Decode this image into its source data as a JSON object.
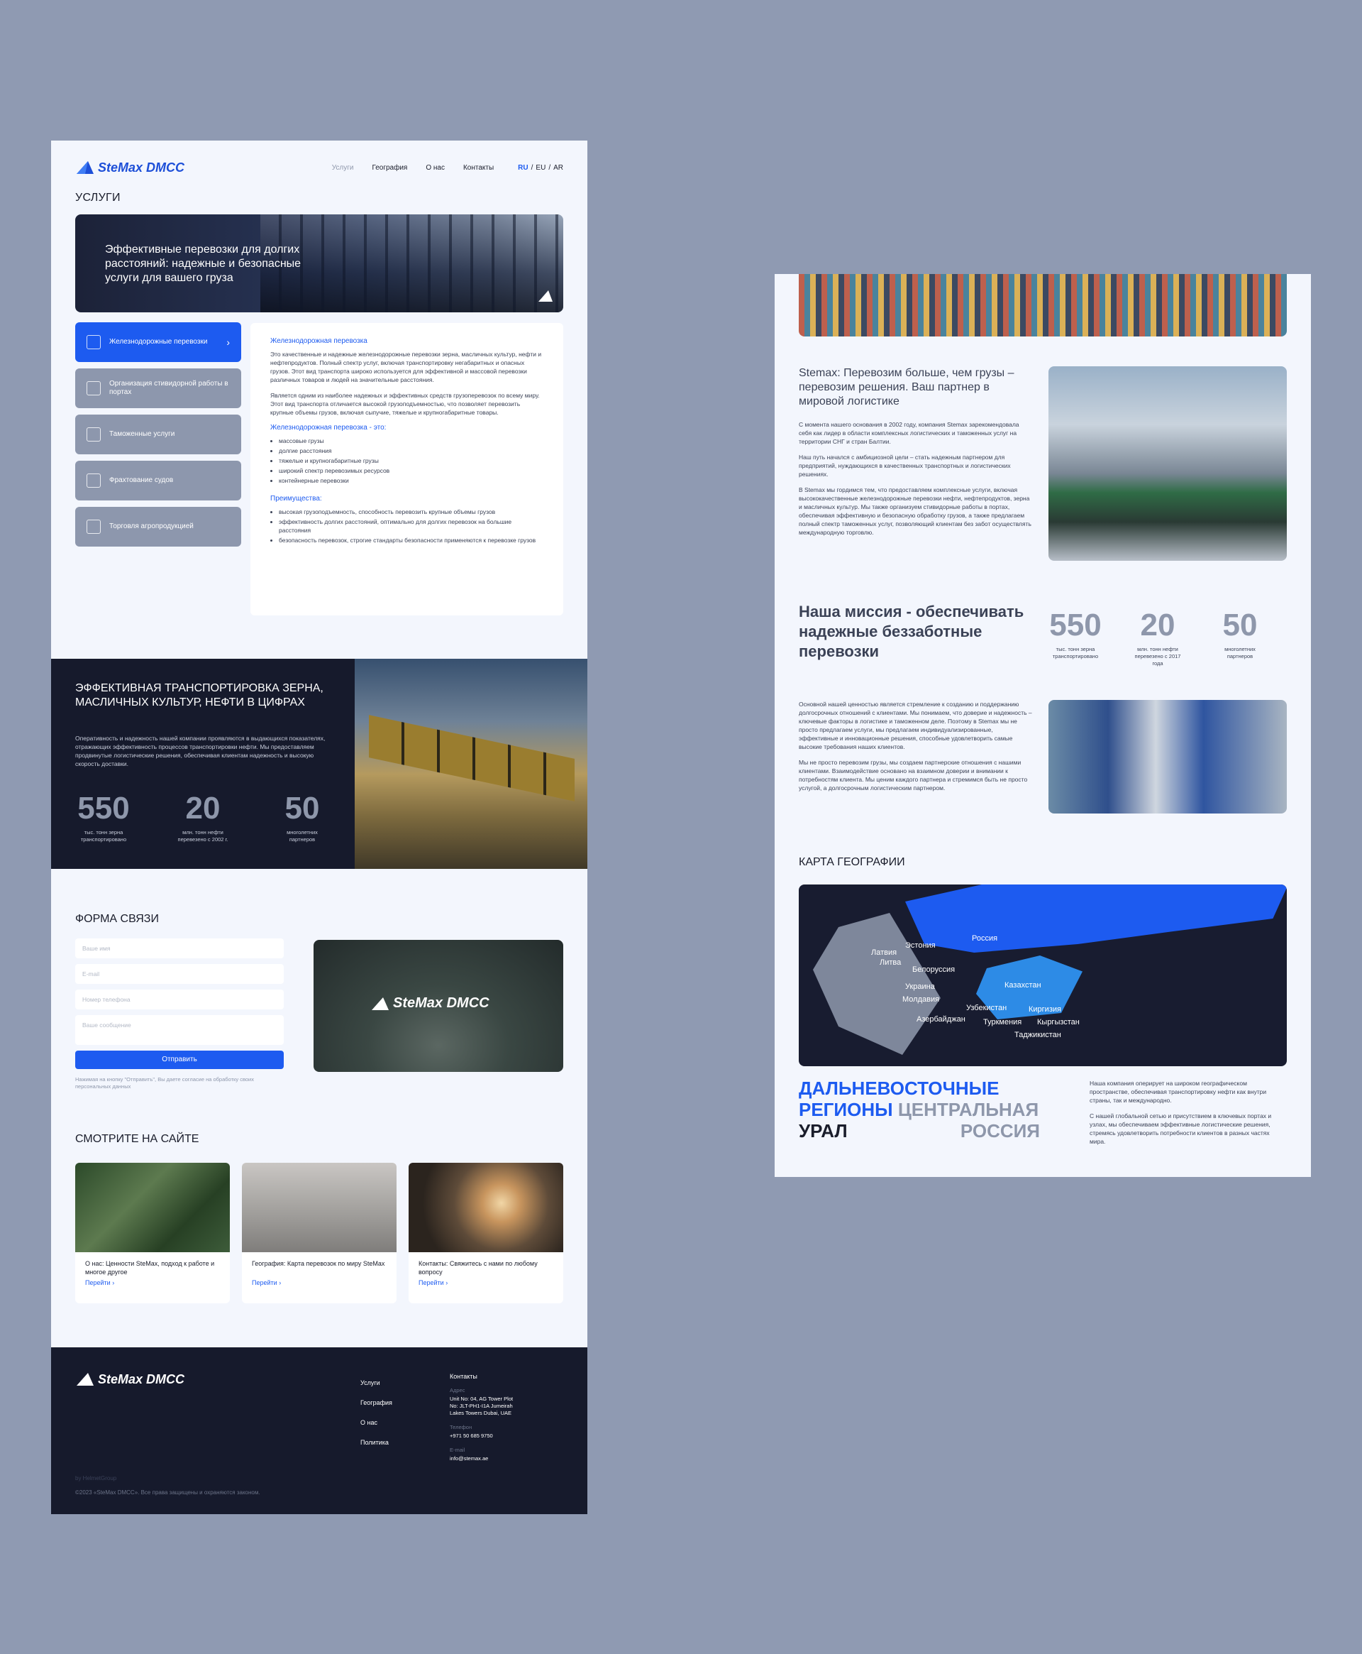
{
  "brand": "SteMax DMCC",
  "nav": [
    "Услуги",
    "География",
    "О нас",
    "Контакты"
  ],
  "langs": [
    "RU",
    "EU",
    "AR"
  ],
  "services_title": "УСЛУГИ",
  "hero_text": "Эффективные перевозки для долгих расстояний: надежные и безопасные услуги для вашего груза",
  "services": [
    {
      "label": "Железнодорожные перевозки",
      "icon": "rail-icon"
    },
    {
      "label": "Организация стивидорной работы в портах",
      "icon": "crane-icon"
    },
    {
      "label": "Таможенные услуги",
      "icon": "customs-icon"
    },
    {
      "label": "Фрахтование судов",
      "icon": "ship-icon"
    },
    {
      "label": "Торговля агропродукцией",
      "icon": "grain-icon"
    }
  ],
  "service_card": {
    "title": "Железнодорожная перевозка",
    "p1": "Это качественные и надежные железнодорожные перевозки зерна, масличных культур, нефти и нефтепродуктов. Полный спектр услуг, включая транспортировку негабаритных и опасных грузов. Этот вид транспорта широко используется для эффективной и массовой перевозки различных товаров и людей на значительные расстояния.",
    "p2": "Является одним из наиболее надежных и эффективных средств грузоперевозок по всему миру. Этот вид транспорта отличается высокой грузоподъемностью, что позволяет перевозить крупные объемы грузов, включая сыпучие, тяжелые и крупногабаритные товары.",
    "list_title": "Железнодорожная перевозка - это:",
    "list": [
      "массовые грузы",
      "долгие расстояния",
      "тяжелые и крупногабаритные грузы",
      "широкий спектр перевозимых ресурсов",
      "контейнерные перевозки"
    ],
    "adv_title": "Преимущества:",
    "adv": [
      "высокая грузоподъемность, способность перевозить крупные объемы грузов",
      "эффективность долгих расстояний, оптимально для долгих перевозок на большие расстояния",
      "безопасность перевозок, строгие стандарты безопасности применяются к перевозке грузов"
    ]
  },
  "stats_band": {
    "title": "ЭФФЕКТИВНАЯ ТРАНСПОРТИРОВКА ЗЕРНА, МАСЛИЧНЫХ КУЛЬТУР, НЕФТИ В ЦИФРАХ",
    "desc": "Оперативность и надежность нашей компании проявляются в выдающихся показателях, отражающих эффективность процессов транспортировки нефти. Мы предоставляем продвинутые логистические решения, обеспечивая клиентам надежность и высокую скорость доставки.",
    "stats": [
      {
        "n": "550",
        "c": "тыс. тонн зерна транспортировано"
      },
      {
        "n": "20",
        "c": "млн. тонн нефти перевезено с 2002 г."
      },
      {
        "n": "50",
        "c": "многолетних партнеров"
      }
    ]
  },
  "form": {
    "title": "ФОРМА СВЯЗИ",
    "name": "Ваше имя",
    "email": "E-mail",
    "phone": "Номер телефона",
    "message": "Ваше сообщение",
    "submit": "Отправить",
    "consent": "Нажимая на кнопку \"Отправить\", Вы даете согласие на обработку своих персональных данных"
  },
  "see": {
    "title": "СМОТРИТЕ НА САЙТЕ",
    "cards": [
      {
        "t": "О нас: Ценности SteMax, подход к работе и многое другое",
        "go": "Перейти"
      },
      {
        "t": "География: Карта перевозок по миру SteMax",
        "go": "Перейти"
      },
      {
        "t": "Контакты: Свяжитесь с нами по любому вопросу",
        "go": "Перейти"
      }
    ]
  },
  "footer": {
    "links": [
      "Услуги",
      "География",
      "О нас",
      "Политика"
    ],
    "contacts_title": "Контакты",
    "addr_label": "Адрес",
    "addr": "Unit No: 04, AG Tower Plot No: JLT-PH1-I1A Jumeirah Lakes Towers Dubai, UAE",
    "tel_label": "Телефон",
    "tel": "+971 50 685 9750",
    "email_label": "E-mail",
    "email": "info@stemax.ae",
    "by": "by HelmetGroup",
    "copy": "©2023 «SteMax DMCC». Все права защищены и охраняются законом."
  },
  "right": {
    "h1": "Stemax: Перевозим больше, чем грузы – перевозим решения. Ваш партнер в мировой логистике",
    "p1": "С момента нашего основания в 2002 году, компания Stemax зарекомендовала себя как лидер в области комплексных логистических и таможенных услуг на территории СНГ и стран Балтии.",
    "p2": "Наш путь начался с амбициозной цели – стать надежным партнером для предприятий, нуждающихся в качественных транспортных и логистических решениях.",
    "p3": "В Stemax мы гордимся тем, что предоставляем комплексные услуги, включая высококачественные железнодорожные перевозки нефти, нефтепродуктов, зерна и масличных культур. Мы также организуем стивидорные работы в портах, обеспечивая эффективную и безопасную обработку грузов, а также предлагаем полный спектр таможенных услуг, позволяющий клиентам без забот осуществлять международную торговлю.",
    "mission": "Наша миссия - обеспечивать надежные беззаботные перевозки",
    "stats": [
      {
        "n": "550",
        "c": "тыс. тонн зерна транспортировано"
      },
      {
        "n": "20",
        "c": "млн. тонн нефти перевезено с 2017 года"
      },
      {
        "n": "50",
        "c": "многолетних партнеров"
      }
    ],
    "p4": "Основной нашей ценностью является стремление к созданию и поддержанию долгосрочных отношений с клиентами. Мы понимаем, что доверие и надежность – ключевые факторы в логистике и таможенном деле. Поэтому в Stemax мы не просто предлагаем услуги, мы предлагаем индивидуализированные, эффективные и инновационные решения, способные удовлетворить самые высокие требования наших клиентов.",
    "p5": "Мы не просто перевозим грузы, мы создаем партнерские отношения с нашими клиентами. Взаимодействие основано на взаимном доверии и внимании к потребностям клиента. Мы ценим каждого партнера и стремимся быть не просто услугой, а долгосрочным логистическим партнером.",
    "map_title": "КАРТА ГЕОГРАФИИ",
    "map_labels": [
      "Россия",
      "Эстония",
      "Латвия",
      "Литва",
      "Белоруссия",
      "Украина",
      "Молдавия",
      "Казахстан",
      "Узбекистан",
      "Киргизия",
      "Азербайджан",
      "Туркмения",
      "Кыргызстан",
      "Таджикистан"
    ],
    "regions": [
      "ДАЛЬНЕВОСТОЧНЫЕ",
      "РЕГИОНЫ",
      "ЦЕНТРАЛЬНАЯ",
      "УРАЛ",
      "РОССИЯ"
    ],
    "p6": "Наша компания оперирует на широком географическом пространстве, обеспечивая транспортировку нефти как внутри страны, так и международно.",
    "p7": "С нашей глобальной сетью и присутствием в ключевых портах и узлах, мы обеспечиваем эффективные логистические решения, стремясь удовлетворить потребности клиентов в разных частях мира."
  }
}
